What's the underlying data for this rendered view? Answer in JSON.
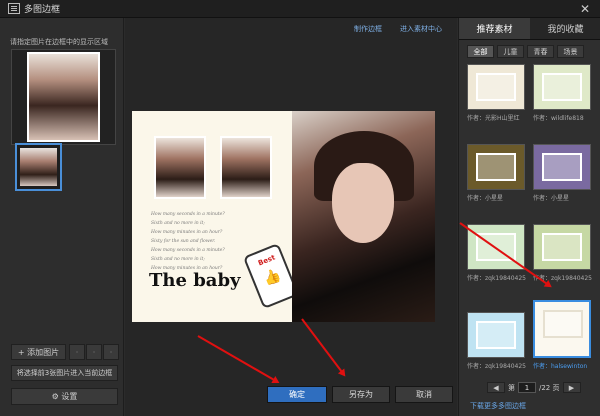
{
  "window": {
    "title": "多图边框",
    "close_glyph": "✕"
  },
  "left": {
    "hint": "请指定图片在边框中的显示区域",
    "add_label": "+ 添加图片",
    "small_btn1": "·",
    "small_btn2": "·",
    "small_btn3": "·",
    "apply_label": "将选择前3张图片进入当前边框",
    "settings_label": "⚙  设置"
  },
  "center": {
    "link_make": "制作边框",
    "link_enter": "进入素材中心",
    "poem": [
      "How many seconds in a minute?",
      "Sixth and no more in it;",
      "How many minutes in an hour?",
      "Sixty for the sun and flower.",
      "How many seconds in a minute?",
      "Sixth and no more in it;",
      "How many minutes in an hour?",
      "Sixty for the sun and flower."
    ],
    "baby_title": "The baby",
    "tag_text": "Best",
    "ok_label": "确定",
    "saveas_label": "另存为",
    "cancel_label": "取消"
  },
  "right": {
    "tab_recommended": "推荐素材",
    "tab_favorites": "我的收藏",
    "subtabs": [
      "全部",
      "儿童",
      "青春",
      "场景"
    ],
    "items": [
      {
        "caption": "作者：光影H山里红"
      },
      {
        "caption": "作者：wildlife818"
      },
      {
        "caption": "作者：小星星"
      },
      {
        "caption": "作者：小星星"
      },
      {
        "caption": "作者：zqk19840425"
      },
      {
        "caption": "作者：zqk19840425"
      },
      {
        "caption": "作者：zqk19840425"
      },
      {
        "caption": "作者：halsewinton"
      }
    ],
    "pager": {
      "prev": "◀",
      "page_label": "第",
      "page_value": "1",
      "total": "/22 页",
      "next": "▶"
    },
    "more_link": "下载更多多图边框"
  },
  "colors": {
    "accent": "#2f6ebf",
    "selection": "#3a8de0",
    "annotation_arrow": "#e01010"
  }
}
